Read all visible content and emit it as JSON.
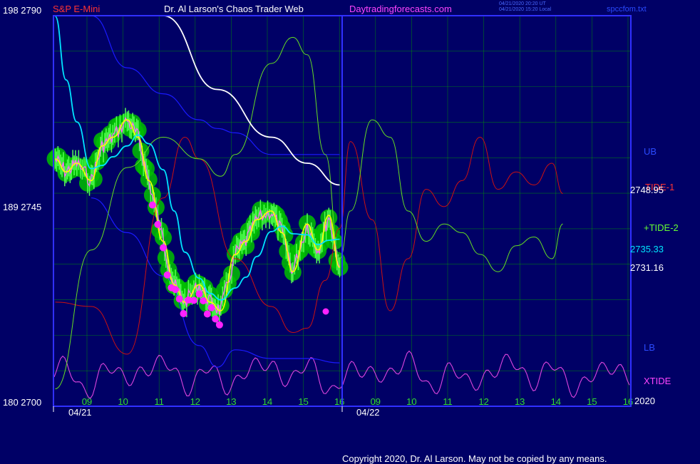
{
  "header": {
    "symbol": "S&P E-Mini",
    "title": "Dr. Al Larson's Chaos Trader Web",
    "site": "Daytradingforecasts.com",
    "stamp_line1": "04/21/2020 20:20 UT",
    "stamp_line2": "04/21/2020 15:20 Local",
    "file": "spccfom.txt"
  },
  "y_labels": {
    "top": "198  2790",
    "mid": "189  2745",
    "bottom": "180  2700"
  },
  "dates": {
    "d1": "04/21",
    "d2": "04/22"
  },
  "right_labels": {
    "ub": "UB",
    "tide1": "TIDE-1",
    "p1": "2748.95",
    "tide2": "+TIDE-2",
    "p2": "2735.33",
    "p3": "2731.16",
    "lb": "LB",
    "xtide": "XTIDE",
    "year": "2020"
  },
  "copyright": "Copyright 2020, Dr. Al Larson. May not be copied by any means.",
  "colors": {
    "background": "#000066",
    "grid": "#00a000",
    "frame": "#3030ff",
    "price": "#ff66ff",
    "glow": "#00c000",
    "ma_fast": "#ffff00",
    "ma_slow": "#00e5ff",
    "ma_long": "#ffffff",
    "bands": "#1a1aff",
    "tide1": "#cc1111",
    "tide2": "#66dd22",
    "xtide": "#dd44dd",
    "dots": "#ff22ff"
  },
  "chart_data": {
    "type": "line",
    "ylim": [
      2700,
      2790
    ],
    "y_ticks": [
      2700,
      2745,
      2790
    ],
    "x_ticks": [
      "09",
      "10",
      "11",
      "12",
      "13",
      "14",
      "15",
      "16",
      "09",
      "10",
      "11",
      "12",
      "13",
      "14",
      "15",
      "16"
    ],
    "x_date_labels": [
      "04/21",
      "04/22"
    ],
    "series": [
      {
        "name": "S&P E-Mini",
        "x": [
          8.0,
          8.3,
          8.6,
          9.0,
          9.3,
          9.6,
          10.0,
          10.3,
          10.6,
          11.0,
          11.3,
          11.6,
          12.0,
          12.3,
          12.6,
          13.0,
          13.3,
          13.6,
          14.0,
          14.3,
          14.6,
          15.0,
          15.3,
          15.6,
          15.9
        ],
        "y": [
          2757,
          2754,
          2756,
          2752,
          2760,
          2762,
          2766,
          2762,
          2752,
          2738,
          2728,
          2724,
          2728,
          2724,
          2722,
          2735,
          2738,
          2743,
          2745,
          2740,
          2731,
          2742,
          2736,
          2744,
          2732
        ]
      },
      {
        "name": "+TIDE-2",
        "x": [
          8.0,
          9.0,
          10.0,
          11.0,
          12.0,
          12.6,
          13.0,
          14.0,
          14.6,
          15.0,
          15.5,
          15.9,
          16.2,
          16.8,
          17.3,
          17.8,
          18.3,
          18.8,
          19.3,
          19.8,
          20.3,
          20.8,
          21.3,
          21.8,
          22.1
        ],
        "y": [
          2704,
          2736,
          2755,
          2762,
          2757,
          2753,
          2758,
          2779,
          2785,
          2781,
          2758,
          2734,
          2745,
          2766,
          2762,
          2745,
          2738,
          2742,
          2740,
          2735,
          2731,
          2737,
          2739,
          2734,
          2742
        ]
      },
      {
        "name": "TIDE-1",
        "x": [
          8.0,
          9.0,
          10.0,
          11.0,
          11.6,
          12.0,
          13.0,
          14.0,
          14.6,
          15.0,
          15.5,
          15.9,
          16.2,
          16.8,
          17.3,
          17.8,
          18.3,
          18.8,
          19.3,
          19.8,
          20.3,
          20.8,
          21.3,
          21.8,
          22.1
        ],
        "y": [
          2724,
          2723,
          2712,
          2748,
          2762,
          2757,
          2734,
          2723,
          2717,
          2718,
          2729,
          2741,
          2761,
          2743,
          2722,
          2734,
          2750,
          2746,
          2752,
          2762,
          2750,
          2754,
          2751,
          2756,
          2749
        ]
      },
      {
        "name": "UB",
        "x": [
          9.0,
          10.0,
          11.0,
          12.0,
          12.5,
          13.0,
          14.0,
          15.0,
          15.9
        ],
        "y": [
          2790,
          2778,
          2772,
          2766,
          2764,
          2763,
          2758,
          2758,
          2758
        ]
      },
      {
        "name": "LB",
        "x": [
          9.0,
          10.0,
          11.0,
          12.0,
          12.5,
          13.0,
          14.0,
          15.0,
          15.9
        ],
        "y": [
          2748,
          2740,
          2730,
          2714,
          2709,
          2713,
          2711,
          2711,
          2710
        ]
      }
    ]
  }
}
